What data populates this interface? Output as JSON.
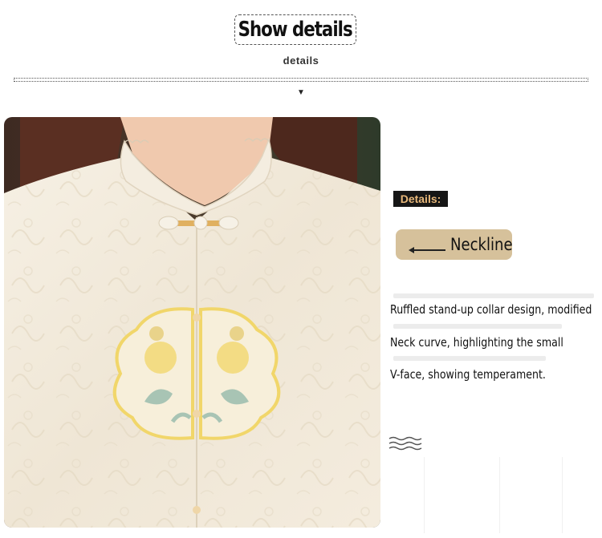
{
  "header": {
    "title": "Show details",
    "subtitle": "details"
  },
  "details_tag": "Details:",
  "feature_label": "Neckline",
  "description": {
    "line1": "Ruffled stand-up collar design, modified",
    "line2": "Neck curve, highlighting the small",
    "line3": "V-face, showing temperament."
  },
  "icons": {
    "down_arrow": "triangle-down-icon",
    "pointer_arrow": "arrow-left-icon",
    "waves": "wave-lines-icon"
  },
  "colors": {
    "tag_background": "#161616",
    "tag_text": "#e8b87a",
    "pill_background": "#d6c19b",
    "fabric": "#f2eadb",
    "embroidery_yellow": "#f1d66a",
    "embroidery_green": "#a8c4b4"
  }
}
